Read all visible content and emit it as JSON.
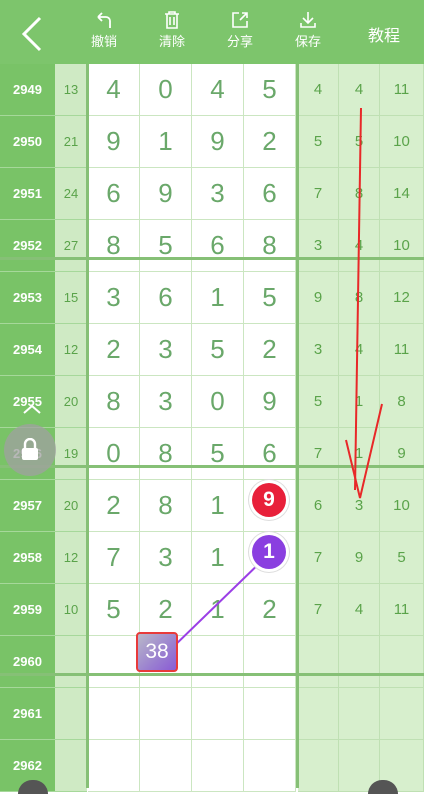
{
  "toolbar": {
    "undo_label": "撤销",
    "clear_label": "清除",
    "share_label": "分享",
    "save_label": "保存",
    "tutorial_label": "教程"
  },
  "rows": [
    {
      "issue": "2949",
      "sum": "13",
      "d": [
        "4",
        "0",
        "4",
        "5"
      ],
      "s": [
        "4",
        "4",
        "11"
      ]
    },
    {
      "issue": "2950",
      "sum": "21",
      "d": [
        "9",
        "1",
        "9",
        "2"
      ],
      "s": [
        "5",
        "5",
        "10"
      ]
    },
    {
      "issue": "2951",
      "sum": "24",
      "d": [
        "6",
        "9",
        "3",
        "6"
      ],
      "s": [
        "7",
        "8",
        "14"
      ]
    },
    {
      "issue": "2952",
      "sum": "27",
      "d": [
        "8",
        "5",
        "6",
        "8"
      ],
      "s": [
        "3",
        "4",
        "10"
      ]
    },
    {
      "issue": "2953",
      "sum": "15",
      "d": [
        "3",
        "6",
        "1",
        "5"
      ],
      "s": [
        "9",
        "8",
        "12"
      ]
    },
    {
      "issue": "2954",
      "sum": "12",
      "d": [
        "2",
        "3",
        "5",
        "2"
      ],
      "s": [
        "3",
        "4",
        "11"
      ]
    },
    {
      "issue": "2955",
      "sum": "20",
      "d": [
        "8",
        "3",
        "0",
        "9"
      ],
      "s": [
        "5",
        "1",
        "8"
      ]
    },
    {
      "issue": "2956",
      "sum": "19",
      "d": [
        "0",
        "8",
        "5",
        "6"
      ],
      "s": [
        "7",
        "1",
        "9"
      ]
    },
    {
      "issue": "2957",
      "sum": "20",
      "d": [
        "2",
        "8",
        "1",
        ""
      ],
      "s": [
        "6",
        "3",
        "10"
      ]
    },
    {
      "issue": "2958",
      "sum": "12",
      "d": [
        "7",
        "3",
        "1",
        ""
      ],
      "s": [
        "7",
        "9",
        "5"
      ]
    },
    {
      "issue": "2959",
      "sum": "10",
      "d": [
        "5",
        "2",
        "1",
        "2"
      ],
      "s": [
        "7",
        "4",
        "11"
      ]
    },
    {
      "issue": "2960",
      "sum": "",
      "d": [
        "",
        "",
        "",
        ""
      ],
      "s": [
        "",
        "",
        ""
      ]
    },
    {
      "issue": "2961",
      "sum": "",
      "d": [
        "",
        "",
        "",
        ""
      ],
      "s": [
        "",
        "",
        ""
      ]
    },
    {
      "issue": "2962",
      "sum": "",
      "d": [
        "",
        "",
        "",
        ""
      ],
      "s": [
        "",
        "",
        ""
      ]
    }
  ],
  "markers": {
    "ball_red": "9",
    "ball_purple": "1",
    "selected_value": "38"
  },
  "colors": {
    "toolbar_green": "#7dc56c",
    "issue_green": "#79c367",
    "ball_red": "#e8203a",
    "ball_purple": "#8a3fe0",
    "arrow_red": "#e82828"
  },
  "icons": [
    "back-chevron-icon",
    "undo-icon",
    "trash-icon",
    "share-icon",
    "download-icon",
    "lock-icon"
  ]
}
